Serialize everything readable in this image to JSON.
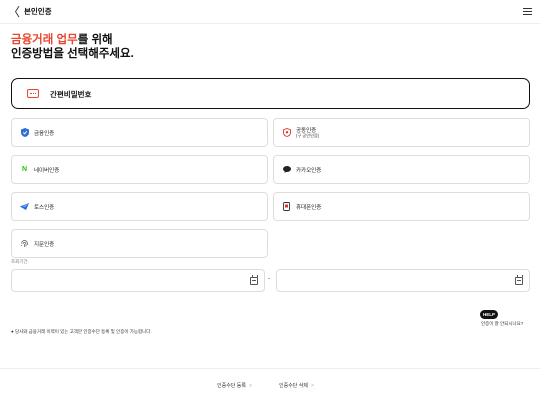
{
  "header": {
    "back_glyph": "〈",
    "title": "본인인증"
  },
  "headline": {
    "accent": "금융거래 업무",
    "line1_rest": "를 위해",
    "line2": "인증방법을 선택해주세요."
  },
  "primary_method": {
    "label": "간편비밀번호",
    "icon": "password-pad-icon"
  },
  "methods": [
    {
      "label": "금융인증",
      "icon": "shield-icon",
      "color": "#2f6fd6"
    },
    {
      "label": "공동인증",
      "sub": "(구 공인인증)",
      "icon": "badge-icon",
      "color": "#d8352c"
    },
    {
      "label": "네이버인증",
      "icon": "naver-icon",
      "color": "#1ec800"
    },
    {
      "label": "카카오인증",
      "icon": "kakao-icon",
      "color": "#222222"
    },
    {
      "label": "토스인증",
      "icon": "toss-icon",
      "color": "#1b64da"
    },
    {
      "label": "휴대폰인증",
      "icon": "phone-icon",
      "color": "#333333"
    },
    {
      "label": "지문인증",
      "icon": "fingerprint-icon",
      "color": "#555555"
    }
  ],
  "period": {
    "label": "조회기간",
    "start_value": "",
    "end_value": "",
    "separator": "-"
  },
  "help": {
    "badge": "HELP",
    "text": "인증이 잘 안되시나요?"
  },
  "notice": "● 당사와 금융거래 이력이 있는 고객만 인증수단 등록 및 인증이 가능합니다.",
  "footer": {
    "register": "인증수단 등록",
    "delete": "인증수단 삭제",
    "arrow": ">"
  }
}
